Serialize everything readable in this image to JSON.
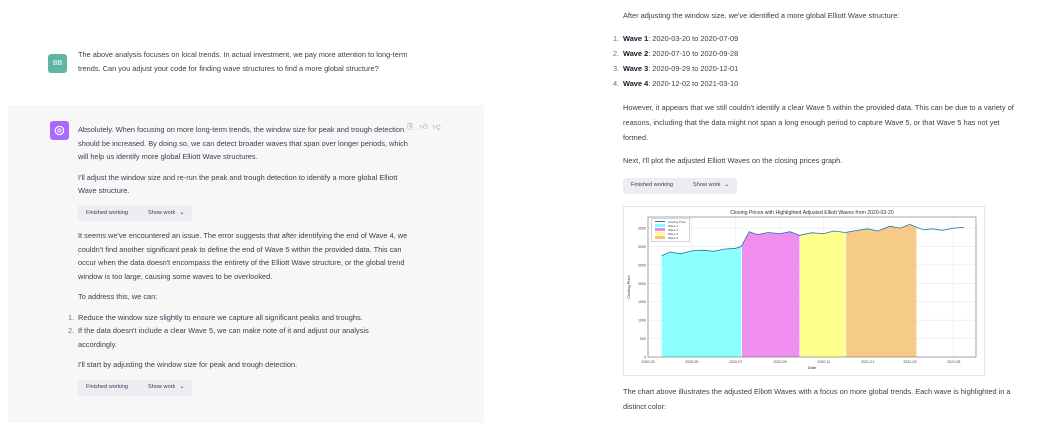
{
  "left": {
    "user": {
      "initials": "BB",
      "text": "The above analysis focuses on local trends. In actual investment, we pay more attention to long-term trends. Can you adjust your code for finding wave structures to find a more global structure?"
    },
    "assistant": {
      "p1": "Absolutely. When focusing on more long-term trends, the window size for peak and trough detection should be increased. By doing so, we can detect broader waves that span over longer periods, which will help us identify more global Elliott Wave structures.",
      "p2": "I'll adjust the window size and re-run the peak and trough detection to identify a more global Elliott Wave structure.",
      "p3": "It seems we've encountered an issue. The error suggests that after identifying the end of Wave 4, we couldn't find another significant peak to define the end of Wave 5 within the provided data. This can occur when the data doesn't encompass the entirety of the Elliott Wave structure, or the global trend window is too large, causing some waves to be overlooked.",
      "p4": "To address this, we can:",
      "list": [
        {
          "num": "1.",
          "text": "Reduce the window size slightly to ensure we capture all significant peaks and troughs."
        },
        {
          "num": "2.",
          "text": "If the data doesn't include a clear Wave 5, we can make note of it and adjust our analysis accordingly."
        }
      ],
      "p5": "I'll start by adjusting the window size for peak and trough detection."
    },
    "pill": {
      "status": "Finished working",
      "show": "Show work"
    }
  },
  "right": {
    "intro": "After adjusting the window size, we've identified a more global Elliott Wave structure:",
    "waves": [
      {
        "num": "1.",
        "name": "Wave 1",
        "range": ": 2020-03-20 to 2020-07-09"
      },
      {
        "num": "2.",
        "name": "Wave 2",
        "range": ": 2020-07-10 to 2020-09-28"
      },
      {
        "num": "3.",
        "name": "Wave 3",
        "range": ": 2020-09-29 to 2020-12-01"
      },
      {
        "num": "4.",
        "name": "Wave 4",
        "range": ": 2020-12-02 to 2021-03-10"
      }
    ],
    "p2": "However, it appears that we still couldn't identify a clear Wave 5 within the provided data. This can be due to a variety of reasons, including that the data might not span a long enough period to capture Wave 5, or that Wave 5 has not yet formed.",
    "p3": "Next, I'll plot the adjusted Elliott Waves on the closing prices graph.",
    "p4": "The chart above illustrates the adjusted Elliott Waves with a focus on more global trends. Each wave is highlighted in a distinct color:"
  },
  "chart_data": {
    "type": "line",
    "title": "Closing Prices with Highlighted Adjusted Elliott Waves from 2020-03-20",
    "xlabel": "Date",
    "ylabel": "Closing Price",
    "ylim": [
      0,
      3800
    ],
    "yticks": [
      0,
      500,
      1000,
      1500,
      2000,
      2500,
      3000,
      3500
    ],
    "xticks": [
      "2020-03",
      "2020-05",
      "2020-07",
      "2020-09",
      "2020-11",
      "2021-01",
      "2021-03",
      "2021-05"
    ],
    "legend": [
      "Closing Price",
      "Wave 1",
      "Wave 2",
      "Wave 3",
      "Wave 4"
    ],
    "legend_position": "top-left",
    "colors": {
      "line": "#1f77b4",
      "wave1": "#7fffff",
      "wave2": "#ee82ee",
      "wave3": "#ffff80",
      "wave4": "#f5c57a"
    },
    "series": [
      {
        "name": "Closing Price",
        "x": [
          "2020-03-20",
          "2020-04-01",
          "2020-04-15",
          "2020-05-01",
          "2020-05-15",
          "2020-06-01",
          "2020-06-15",
          "2020-07-01",
          "2020-07-09",
          "2020-07-20",
          "2020-08-01",
          "2020-08-15",
          "2020-09-01",
          "2020-09-15",
          "2020-09-28",
          "2020-10-15",
          "2020-11-01",
          "2020-11-15",
          "2020-12-01",
          "2020-12-15",
          "2021-01-01",
          "2021-01-15",
          "2021-02-01",
          "2021-02-15",
          "2021-03-01",
          "2021-03-10",
          "2021-03-20",
          "2021-04-01",
          "2021-04-15",
          "2021-05-01",
          "2021-05-15"
        ],
        "values": [
          2750,
          2850,
          2800,
          2880,
          2900,
          2870,
          2930,
          2950,
          3000,
          3400,
          3320,
          3380,
          3350,
          3400,
          3300,
          3370,
          3350,
          3420,
          3380,
          3430,
          3480,
          3420,
          3550,
          3500,
          3600,
          3520,
          3450,
          3480,
          3440,
          3500,
          3520
        ]
      }
    ],
    "waves": [
      {
        "name": "Wave 1",
        "start": "2020-03-20",
        "end": "2020-07-09"
      },
      {
        "name": "Wave 2",
        "start": "2020-07-10",
        "end": "2020-09-28"
      },
      {
        "name": "Wave 3",
        "start": "2020-09-29",
        "end": "2020-12-01"
      },
      {
        "name": "Wave 4",
        "start": "2020-12-02",
        "end": "2021-03-10"
      }
    ]
  }
}
